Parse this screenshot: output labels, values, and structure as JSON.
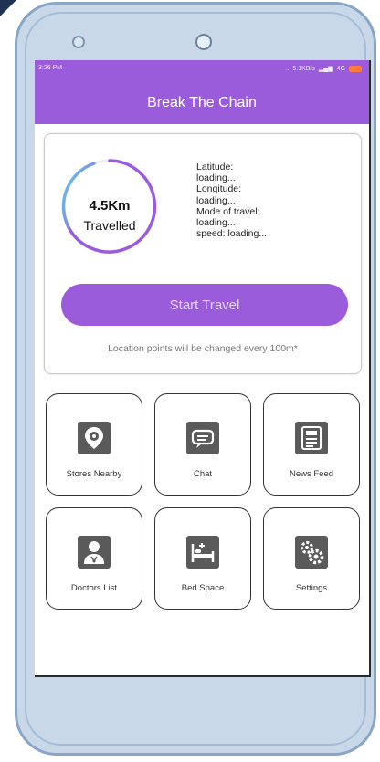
{
  "status_bar": {
    "time": "3:26 PM",
    "network": "... 5.1KB/s",
    "signal": "4G"
  },
  "app_bar": {
    "title": "Break The Chain",
    "accent_color": "#9b5cdb"
  },
  "travel": {
    "distance": "4.5Km",
    "distance_label": "Travelled",
    "info_lines": [
      "Latitude:",
      "loading...",
      "Longitude:",
      "loading...",
      "Mode of travel:",
      "loading...",
      "speed: loading..."
    ],
    "start_button_label": "Start Travel",
    "note": "Location points will be changed every 100m*"
  },
  "menu": {
    "items": [
      {
        "label": "Stores Nearby",
        "icon": "location-pin-icon"
      },
      {
        "label": "Chat",
        "icon": "chat-icon"
      },
      {
        "label": "News Feed",
        "icon": "newspaper-icon"
      },
      {
        "label": "Doctors List",
        "icon": "doctor-icon"
      },
      {
        "label": "Bed Space",
        "icon": "bed-icon"
      },
      {
        "label": "Settings",
        "icon": "gears-icon"
      }
    ]
  }
}
